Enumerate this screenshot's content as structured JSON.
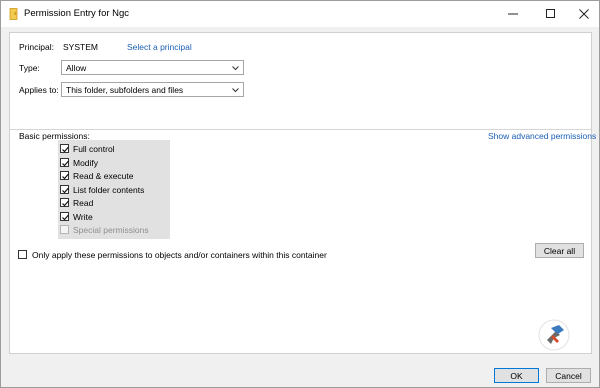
{
  "window": {
    "title": "Permission Entry for Ngc"
  },
  "principal": {
    "label": "Principal:",
    "value": "SYSTEM",
    "link": "Select a principal"
  },
  "type": {
    "label": "Type:",
    "value": "Allow"
  },
  "applies_to": {
    "label": "Applies to:",
    "value": "This folder, subfolders and files"
  },
  "permissions": {
    "label": "Basic permissions:",
    "advanced_link": "Show advanced permissions",
    "items": [
      {
        "label": "Full control",
        "checked": true,
        "enabled": true
      },
      {
        "label": "Modify",
        "checked": true,
        "enabled": true
      },
      {
        "label": "Read & execute",
        "checked": true,
        "enabled": true
      },
      {
        "label": "List folder contents",
        "checked": true,
        "enabled": true
      },
      {
        "label": "Read",
        "checked": true,
        "enabled": true
      },
      {
        "label": "Write",
        "checked": true,
        "enabled": true
      },
      {
        "label": "Special permissions",
        "checked": false,
        "enabled": false
      }
    ]
  },
  "only_apply": {
    "label": "Only apply these permissions to objects and/or containers within this container",
    "checked": false
  },
  "buttons": {
    "clear_all": "Clear all",
    "ok": "OK",
    "cancel": "Cancel"
  },
  "colors": {
    "link": "#1a5fb4",
    "accent": "#0078d7"
  }
}
